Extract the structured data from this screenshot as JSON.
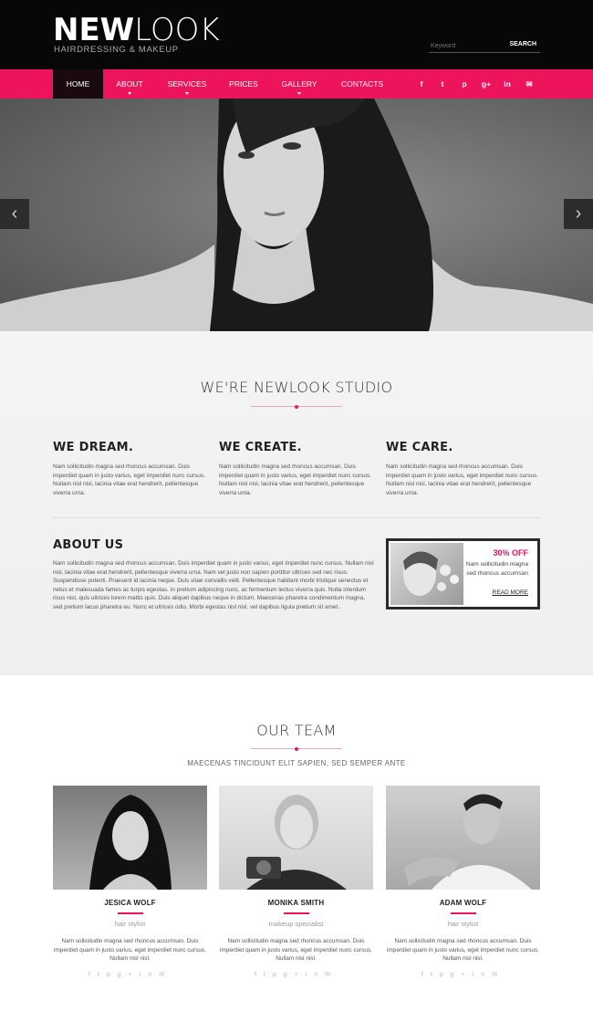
{
  "header": {
    "logo_bold": "NEW",
    "logo_light": "LOOK",
    "tagline": "HAIRDRESSING & MAKEUP",
    "search_placeholder": "Keyword",
    "search_button": "SEARCH"
  },
  "nav": {
    "items": [
      "HOME",
      "ABOUT",
      "SERVICES",
      "PRICES",
      "GALLERY",
      "CONTACTS"
    ],
    "social": [
      "f",
      "t",
      "p",
      "g+",
      "in",
      "✉"
    ]
  },
  "hero": {
    "prev": "‹",
    "next": "›"
  },
  "studio": {
    "title": "WE'RE NEWLOOK STUDIO",
    "columns": [
      {
        "title": "WE DREAM.",
        "text": "Nam sollicitudin magna sed rhoncus accumsan. Duis imperdiet quam in justo varius, eget imperdiet nunc cursus. Nullam nisl nisl, lacinia vitae erat hendrerit, pellentesque viverra urna."
      },
      {
        "title": "WE CREATE.",
        "text": "Nam sollicitudin magna sed rhoncus accumsan. Duis imperdiet quam in justo varius, eget imperdiet nunc cursus. Nullam nisl nisl, lacinia vitae erat hendrerit, pellentesque viverra urna."
      },
      {
        "title": "WE CARE.",
        "text": "Nam sollicitudin magna sed rhoncus accumsan. Duis imperdiet quam in justo varius, eget imperdiet nunc cursus. Nullam nisl nisl, lacinia vitae erat hendrerit, pellentesque viverra urna."
      }
    ],
    "about_title": "ABOUT US",
    "about_text": "Nam sollicitudin magna sed rhoncus accumsan. Duis imperdiet quam in justo varius, eget imperdiet nunc cursus. Nullam nisl nisl, lacinia vitae erat hendrerit, pellentesque viverra urna. Nam vel justo non sapien porttitor ultrices sed nec risus. Suspendisse potenti. Praesent id lacinia neque. Duis vitae convallis velit. Pellentesque habitant morbi tristique senectus et netus et malesuada fames ac turpis egestas. In pretium adipiscing nunc, ac fermentum lectus viverra quis. Nulla interdum risus nisl, quis ultrices lorem mattis quis. Duis aliquet dapibus neque in dictum. Maecenas pharetra condimentum magna, sed pretium lacus pharetra eu. Nunc et ultrices odio. Morbi egestas nisl nisl, vel dapibus ligula pretium sit amet.",
    "promo": {
      "discount": "30% OFF",
      "text": "Nam sollicitudin magna sed rhoncus accumsan",
      "link": "READ MORE"
    }
  },
  "team": {
    "title": "OUR TEAM",
    "subtitle": "MAECENAS TINCIDUNT ELIT SAPIEN, SED SEMPER ANTE",
    "members": [
      {
        "name": "JESICA WOLF",
        "role": "hair stylist",
        "text": "Nam sollicitudin magna sed rhoncus accumsan. Duis imperdiet quam in justo varius, eget imperdiet nunc cursus. Nullam nisl nisl."
      },
      {
        "name": "MONIKA SMITH",
        "role": "makeup specialist",
        "text": "Nam sollicitudin magna sed rhoncus accumsan. Duis imperdiet quam in justo varius, eget imperdiet nunc cursus. Nullam nisl nisl."
      },
      {
        "name": "ADAM WOLF",
        "role": "hair stylist",
        "text": "Nam sollicitudin magna sed rhoncus accumsan. Duis imperdiet quam in justo varius, eget imperdiet nunc cursus. Nullam nisl nisl."
      }
    ],
    "icons": [
      "f",
      "t",
      "p",
      "g+",
      "in",
      "✉"
    ]
  },
  "colors": {
    "accent": "#ed145b",
    "header_bg": "#070707"
  }
}
